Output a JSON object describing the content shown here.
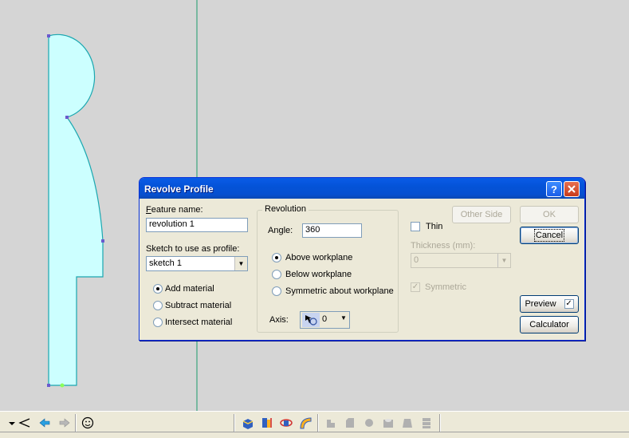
{
  "dialog": {
    "title": "Revolve Profile",
    "help_icon": "question-mark-icon",
    "close_icon": "close-x-icon",
    "feature_name_label": "Feature name:",
    "feature_name_value": "revolution 1",
    "sketch_label": "Sketch to use as profile:",
    "sketch_value": "sketch 1",
    "material_options": [
      "Add material",
      "Subtract material",
      "Intersect material"
    ],
    "material_selected": "Add material",
    "revolution_group_label": "Revolution",
    "angle_label": "Angle:",
    "angle_value": "360",
    "workplane_options": [
      "Above workplane",
      "Below workplane",
      "Symmetric about workplane"
    ],
    "workplane_selected": "Above workplane",
    "axis_label": "Axis:",
    "axis_value": "0",
    "other_side_label": "Other Side",
    "thin_label": "Thin",
    "thin_checked": false,
    "thickness_label": "Thickness (mm):",
    "thickness_value": "0",
    "symmetric_label": "Symmetric",
    "symmetric_checked": true,
    "ok_label": "OK",
    "cancel_label": "Cancel",
    "preview_label": "Preview",
    "preview_checked": true,
    "calculator_label": "Calculator"
  },
  "colors": {
    "title_bar": "#0453d8",
    "profile_fill": "#ccffff",
    "profile_stroke": "#1aa7b0",
    "axis_line": "#1a9a6a",
    "dialog_bg": "#ece9d8"
  },
  "toolbar": {
    "icons": [
      "dropdown-arrow-icon",
      "select-triangle-icon",
      "back-arrow-icon",
      "forward-arrow-icon",
      "smiley-icon",
      "extrude-icon",
      "revolve-icon",
      "sweep-icon",
      "loft-icon",
      "fillet-icon",
      "chamfer-icon",
      "shell-icon",
      "hole-icon",
      "draft-icon",
      "pattern-icon"
    ]
  }
}
